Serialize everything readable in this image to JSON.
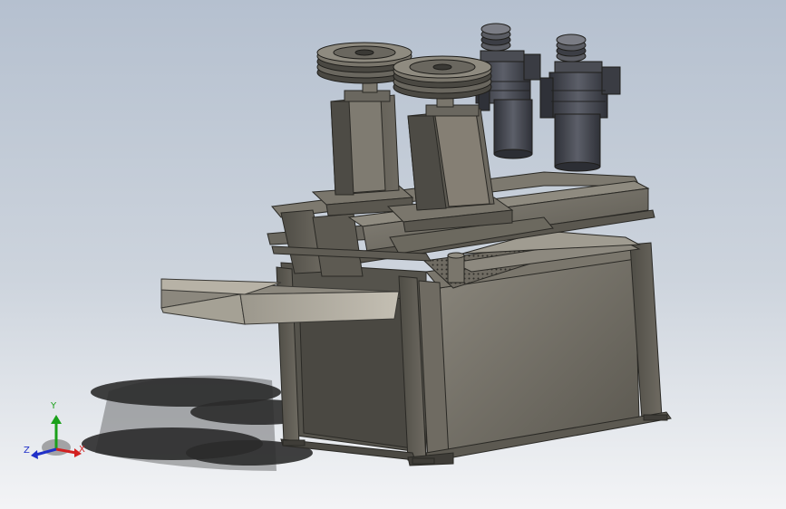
{
  "triad": {
    "x_label": "X",
    "y_label": "Y",
    "z_label": "Z",
    "x_color": "#d22020",
    "y_color": "#1aa01a",
    "z_color": "#2030c8"
  },
  "colors": {
    "steel": "#6d6a62",
    "steel_dark": "#48463f",
    "steel_light": "#8b877d",
    "motor": "#3e4048",
    "shadow": "#2b2b2b"
  }
}
